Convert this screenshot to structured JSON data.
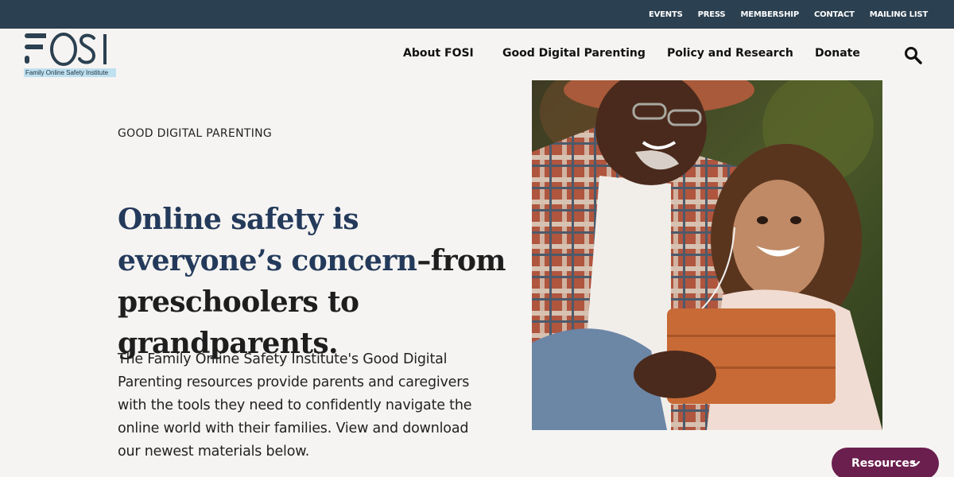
{
  "topbar": {
    "links": [
      "EVENTS",
      "PRESS",
      "MEMBERSHIP",
      "CONTACT",
      "MAILING LIST"
    ]
  },
  "logo": {
    "wordmark": "FOSI",
    "tagline": "Family Online Safety Institute"
  },
  "mainnav": {
    "about": "About FOSI",
    "parenting": "Good Digital Parenting",
    "policy": "Policy and Research",
    "donate": "Donate",
    "search_icon": "search-icon"
  },
  "hero": {
    "eyebrow": "GOOD DIGITAL PARENTING",
    "headline_blue": "Online safety is everyone’s concern",
    "headline_rest": "–from preschoolers to grandparents.",
    "body": "The Family Online Safety Institute's Good Digital Parenting resources provide parents and caregivers with the tools they need to confidently navigate the online world with their families.  View and download our newest materials below."
  },
  "resources": {
    "label": "Resources",
    "icon": "chevron-down-icon"
  },
  "colors": {
    "topbar": "#2b4050",
    "accent": "#6b1f4e",
    "headline_blue": "#243a5b",
    "background": "#f5f4f2"
  }
}
